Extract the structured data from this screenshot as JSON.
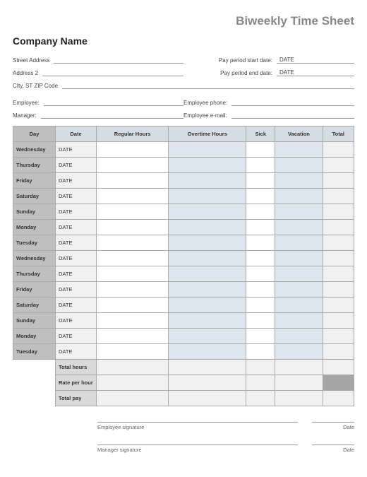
{
  "title": "Biweekly Time Sheet",
  "company": "Company Name",
  "labels": {
    "street": "Street Address",
    "address2": "Address 2",
    "citystzip": "CIty, ST  ZIP Code",
    "pp_start": "Pay period start date:",
    "pp_end": "Pay period end date:",
    "employee": "Employee:",
    "manager": "Manager:",
    "emp_phone": "Employee phone:",
    "emp_email": "Employee e-mail:"
  },
  "values": {
    "pp_start": "DATE",
    "pp_end": "DATE"
  },
  "columns": {
    "day": "Day",
    "date": "Date",
    "regular": "Regular Hours",
    "overtime": "Overtime Hours",
    "sick": "Sick",
    "vacation": "Vacation",
    "total": "Total"
  },
  "rows": [
    {
      "day": "Wednesday",
      "date": "DATE"
    },
    {
      "day": "Thursday",
      "date": "DATE"
    },
    {
      "day": "Friday",
      "date": "DATE"
    },
    {
      "day": "Saturday",
      "date": "DATE"
    },
    {
      "day": "Sunday",
      "date": "DATE"
    },
    {
      "day": "Monday",
      "date": "DATE"
    },
    {
      "day": "Tuesday",
      "date": "DATE"
    },
    {
      "day": "Wednesday",
      "date": "DATE"
    },
    {
      "day": "Thursday",
      "date": "DATE"
    },
    {
      "day": "Friday",
      "date": "DATE"
    },
    {
      "day": "Saturday",
      "date": "DATE"
    },
    {
      "day": "Sunday",
      "date": "DATE"
    },
    {
      "day": "Monday",
      "date": "DATE"
    },
    {
      "day": "Tuesday",
      "date": "DATE"
    }
  ],
  "summary": {
    "total_hours": "Total hours",
    "rate": "Rate per hour",
    "total_pay": "Total pay"
  },
  "signatures": {
    "employee": "Employee signature",
    "manager": "Manager signature",
    "date": "Date"
  }
}
